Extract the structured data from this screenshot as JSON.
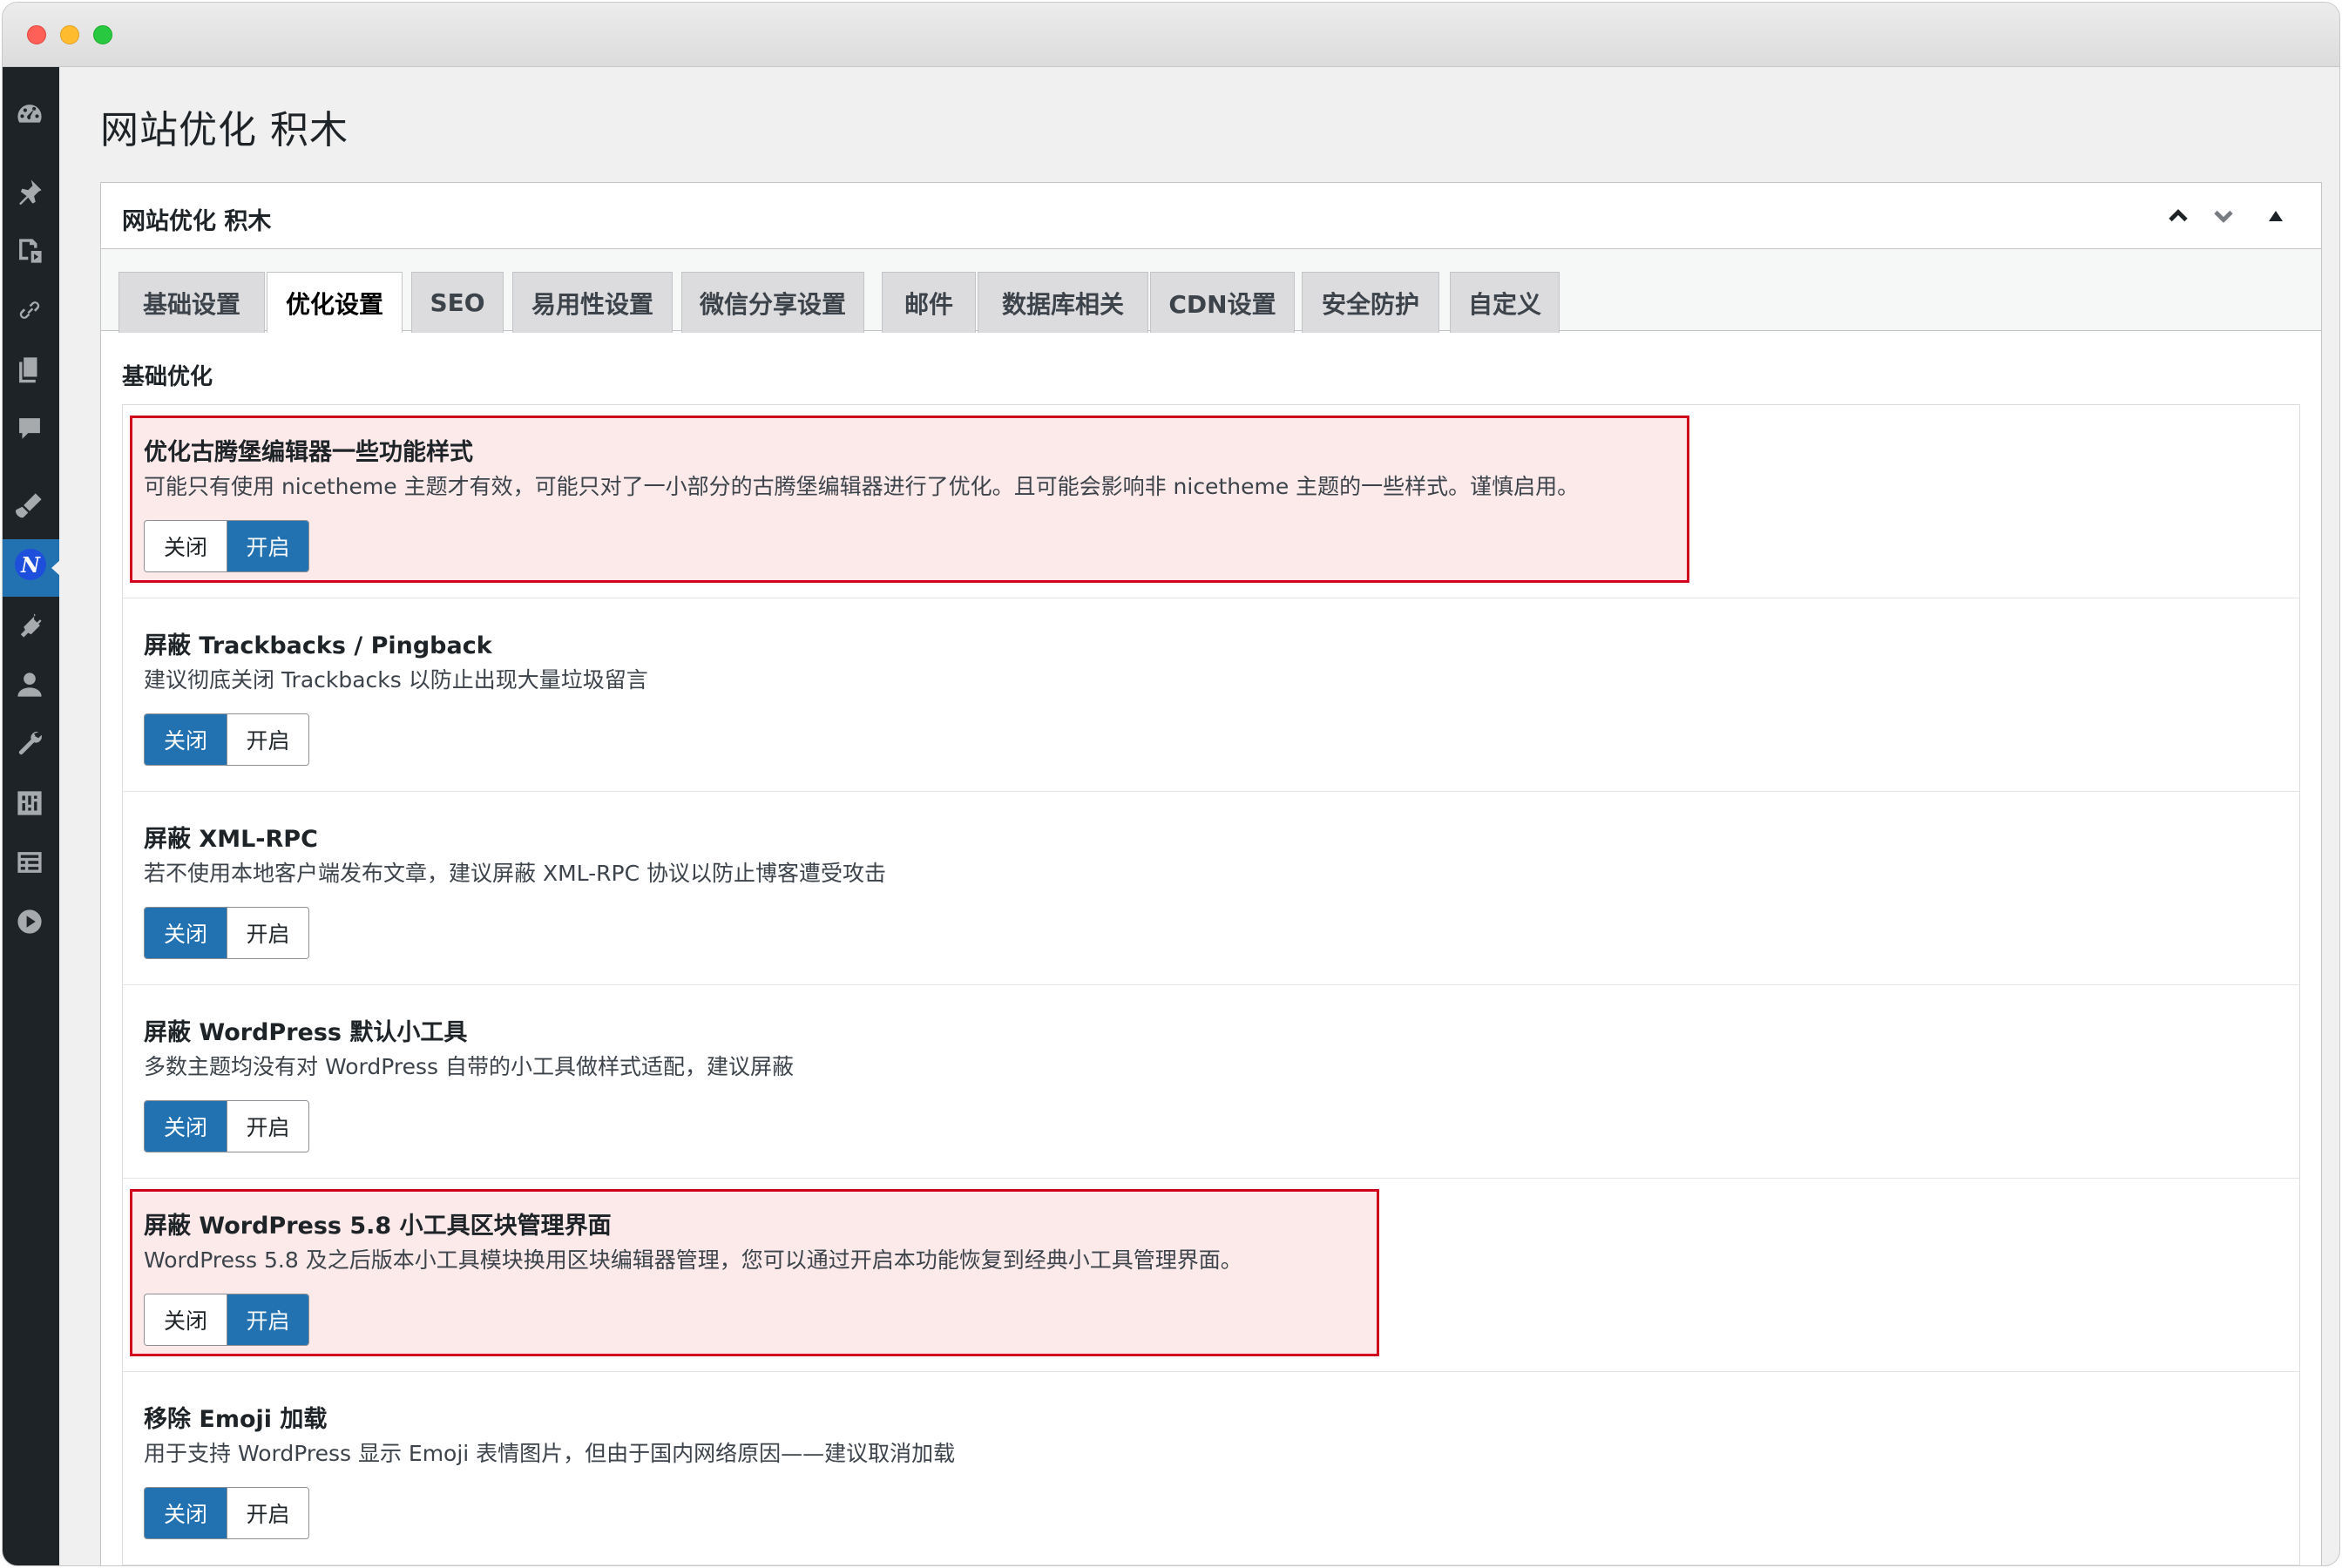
{
  "page": {
    "title": "网站优化 积木"
  },
  "panel": {
    "title": "网站优化 积木"
  },
  "tabs": [
    {
      "label": "基础设置"
    },
    {
      "label": "优化设置",
      "active": true
    },
    {
      "label": "SEO"
    },
    {
      "label": "易用性设置"
    },
    {
      "label": "微信分享设置"
    },
    {
      "label": "邮件"
    },
    {
      "label": "数据库相关"
    },
    {
      "label": "CDN设置"
    },
    {
      "label": "安全防护"
    },
    {
      "label": "自定义"
    }
  ],
  "section": {
    "title": "基础优化"
  },
  "toggle_labels": {
    "off": "关闭",
    "on": "开启"
  },
  "items": [
    {
      "title": "优化古腾堡编辑器一些功能样式",
      "desc": "可能只有使用 nicetheme 主题才有效，可能只对了一小部分的古腾堡编辑器进行了优化。且可能会影响非 nicetheme 主题的一些样式。谨慎启用。",
      "state": "on",
      "highlighted": true
    },
    {
      "title": "屏蔽 Trackbacks / Pingback",
      "desc": "建议彻底关闭 Trackbacks 以防止出现大量垃圾留言",
      "state": "off",
      "highlighted": false
    },
    {
      "title": "屏蔽 XML-RPC",
      "desc": "若不使用本地客户端发布文章，建议屏蔽 XML-RPC 协议以防止博客遭受攻击",
      "state": "off",
      "highlighted": false
    },
    {
      "title": "屏蔽 WordPress 默认小工具",
      "desc": "多数主题均没有对 WordPress 自带的小工具做样式适配，建议屏蔽",
      "state": "off",
      "highlighted": false
    },
    {
      "title": "屏蔽 WordPress 5.8 小工具区块管理界面",
      "desc": "WordPress 5.8 及之后版本小工具模块换用区块编辑器管理，您可以通过开启本功能恢复到经典小工具管理界面。",
      "state": "on",
      "highlighted": true
    },
    {
      "title": "移除 Emoji 加载",
      "desc": "用于支持 WordPress 显示 Emoji 表情图片，但由于国内网络原因——建议取消加载",
      "state": "off",
      "highlighted": false
    }
  ],
  "colors": {
    "accent": "#2271b1",
    "highlight_border": "#d0021b",
    "highlight_bg": "#fceaea",
    "sidebar_bg": "#1d2327"
  }
}
